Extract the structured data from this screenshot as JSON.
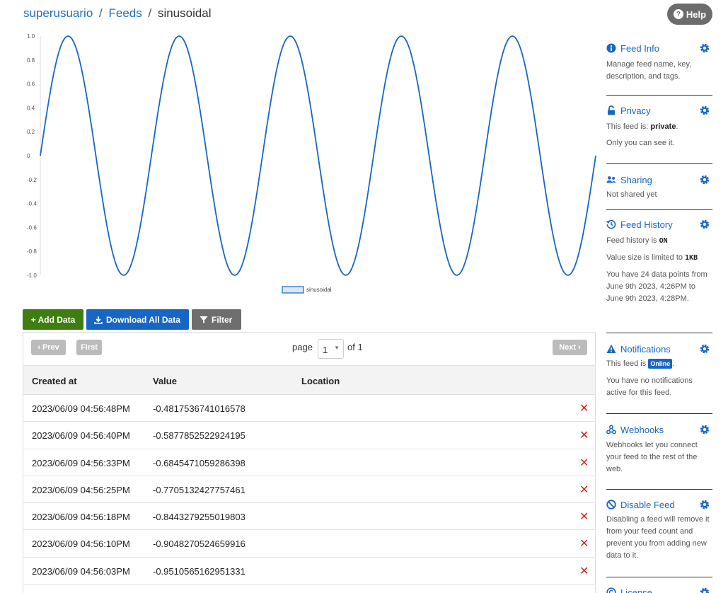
{
  "breadcrumb": {
    "user": "superusuario",
    "sep1": "/",
    "feeds": "Feeds",
    "sep2": "/",
    "feed": "sinusoidal"
  },
  "help": {
    "label": "Help",
    "icon": "question-circle-icon"
  },
  "chart_data": {
    "type": "line",
    "series": [
      {
        "name": "sinusoidal",
        "color": "#1766c4",
        "function": "sin",
        "periods": 5,
        "x_start": 0,
        "x_end": 5.0,
        "points_sampled": 24
      }
    ],
    "ylim": [
      -1.0,
      1.0
    ],
    "y_ticks": [
      "1.0",
      "0.8",
      "0.6",
      "0.4",
      "0.2",
      "0",
      "-0.2",
      "-0.4",
      "-0.6",
      "-0.8",
      "-1.0"
    ],
    "legend": {
      "placement": "bottom-center",
      "label": "sinusoidal"
    },
    "grid": false
  },
  "buttons": {
    "add": "+ Add Data",
    "download": "Download All Data",
    "filter": "Filter"
  },
  "pager": {
    "prev": "Prev",
    "first": "First",
    "label": "page",
    "current": "1",
    "of": "of 1",
    "next": "Next"
  },
  "table": {
    "headers": {
      "created": "Created at",
      "value": "Value",
      "location": "Location"
    },
    "rows": [
      {
        "created": "2023/06/09 04:56:48PM",
        "value": "-0.4817536741016578",
        "location": ""
      },
      {
        "created": "2023/06/09 04:56:40PM",
        "value": "-0.5877852522924195",
        "location": ""
      },
      {
        "created": "2023/06/09 04:56:33PM",
        "value": "-0.6845471059286398",
        "location": ""
      },
      {
        "created": "2023/06/09 04:56:25PM",
        "value": "-0.7705132427757461",
        "location": ""
      },
      {
        "created": "2023/06/09 04:56:18PM",
        "value": "-0.8443279255019803",
        "location": ""
      },
      {
        "created": "2023/06/09 04:56:10PM",
        "value": "-0.9048270524659916",
        "location": ""
      },
      {
        "created": "2023/06/09 04:56:03PM",
        "value": "-0.9510565162951331",
        "location": ""
      }
    ],
    "delete_glyph": "✕"
  },
  "sidebar": {
    "feed_info": {
      "title": "Feed Info",
      "desc": "Manage feed name, key, description, and tags."
    },
    "privacy": {
      "title": "Privacy",
      "line1_pre": "This feed is: ",
      "line1_val": "private",
      "line1_post": ".",
      "line2": "Only you can see it."
    },
    "sharing": {
      "title": "Sharing",
      "desc": "Not shared yet"
    },
    "history": {
      "title": "Feed History",
      "line1_pre": "Feed history is ",
      "line1_val": "ON",
      "line2_pre": "Value size is limited to ",
      "line2_val": "1KB",
      "line3": "You have 24 data points from June 9th 2023, 4:26PM to June 9th 2023, 4:28PM."
    },
    "notifications": {
      "title": "Notifications",
      "line1_pre": "This feed is ",
      "badge": "Online",
      "line1_post": ".",
      "line2": "You have no notifications active for this feed."
    },
    "webhooks": {
      "title": "Webhooks",
      "desc": "Webhooks let you connect your feed to the rest of the web."
    },
    "disable": {
      "title": "Disable Feed",
      "desc": "Disabling a feed will remove it from your feed count and prevent you from adding new data to it."
    },
    "license": {
      "title": "License"
    }
  }
}
